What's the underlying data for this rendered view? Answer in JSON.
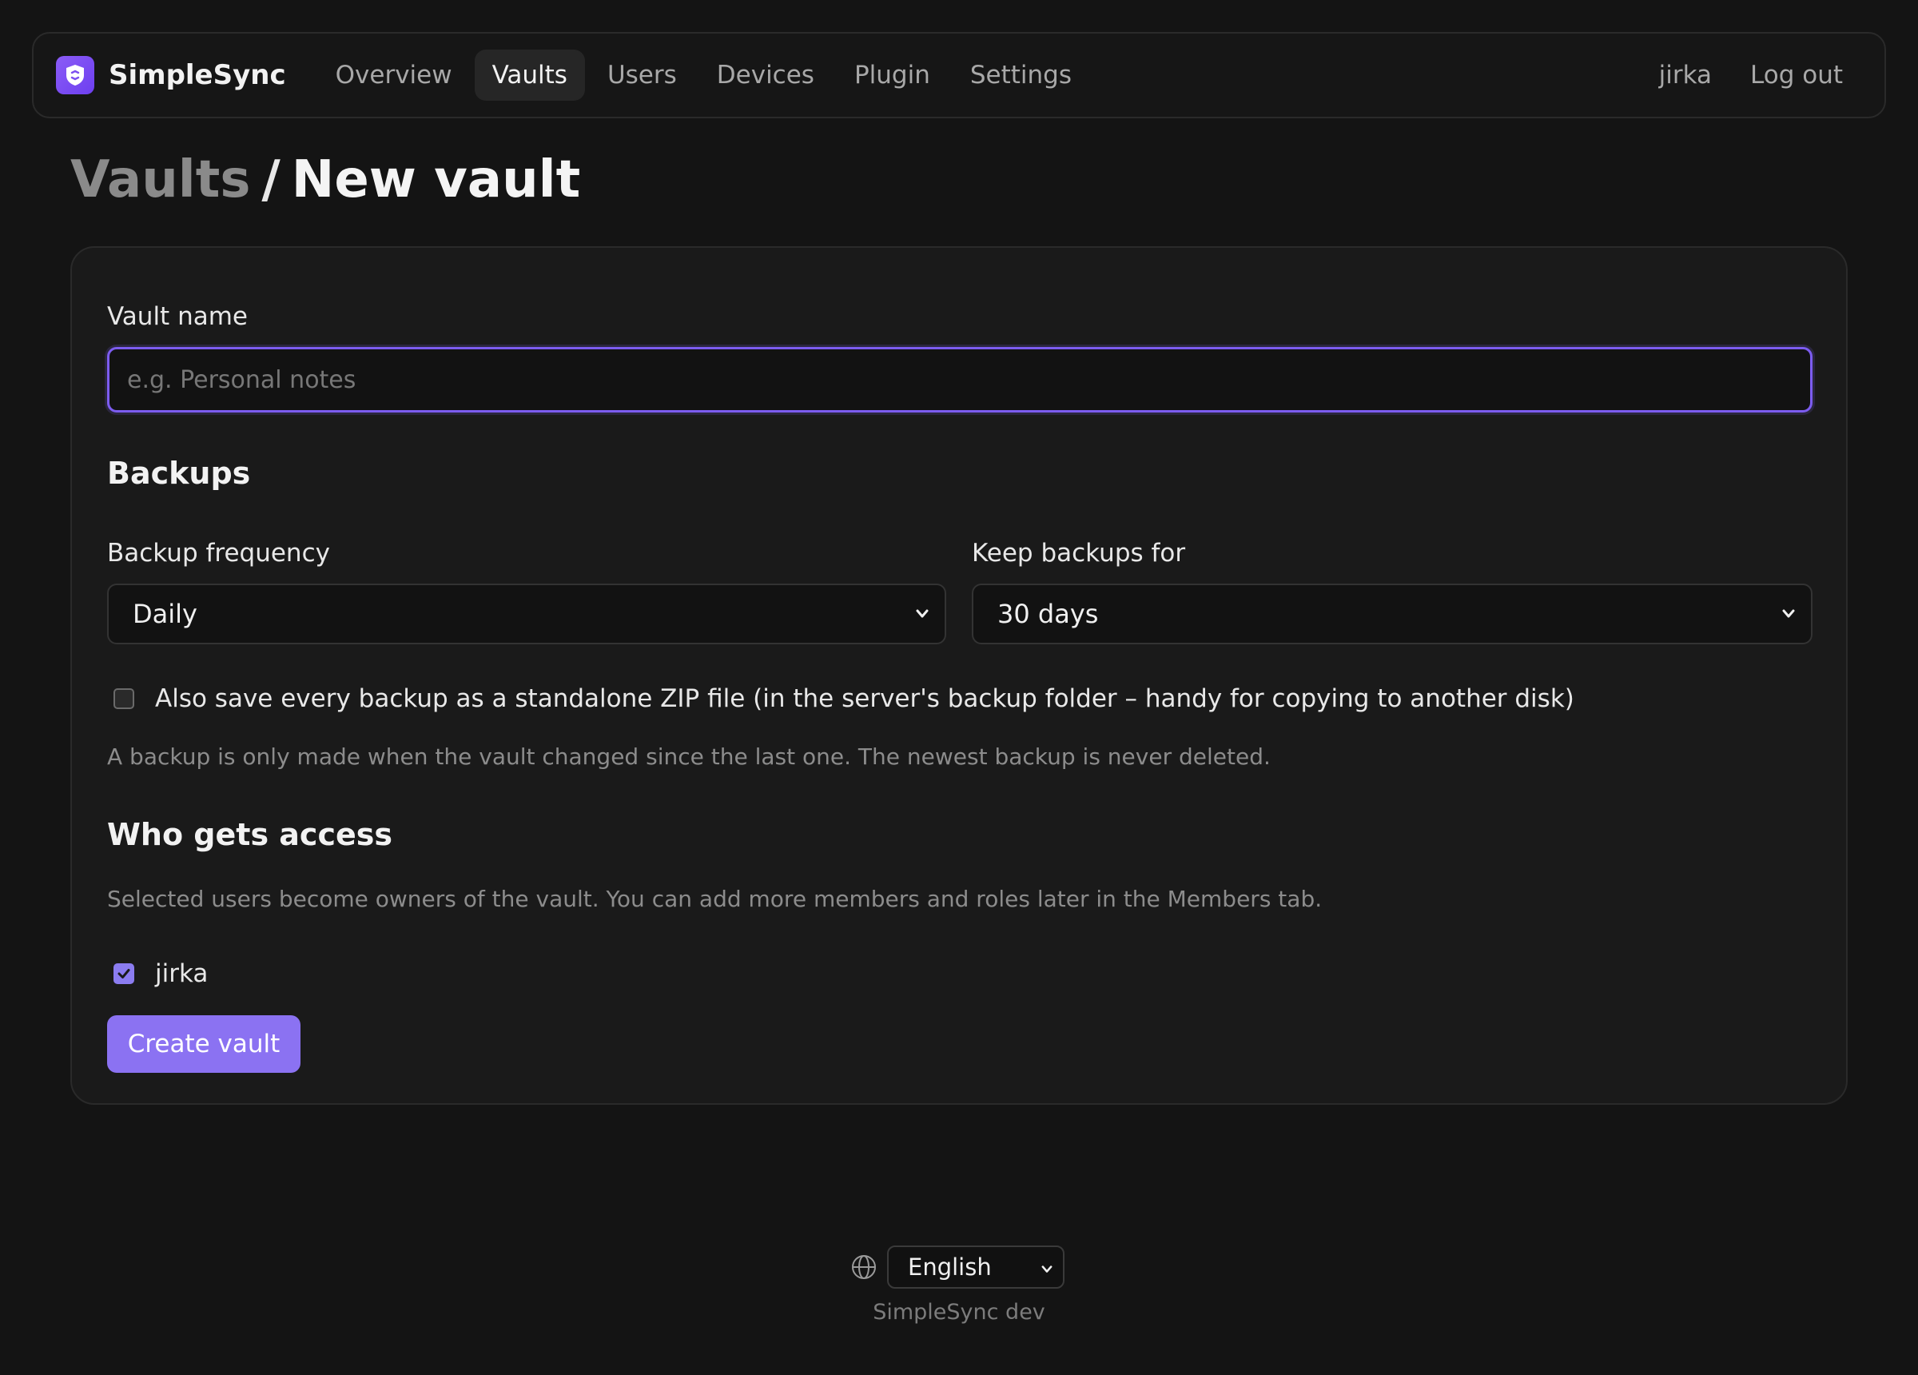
{
  "brand": {
    "name": "SimpleSync",
    "accent": "#8b5cf6"
  },
  "nav": {
    "items": [
      {
        "label": "Overview",
        "active": false
      },
      {
        "label": "Vaults",
        "active": true
      },
      {
        "label": "Users",
        "active": false
      },
      {
        "label": "Devices",
        "active": false
      },
      {
        "label": "Plugin",
        "active": false
      },
      {
        "label": "Settings",
        "active": false
      }
    ],
    "user": "jirka",
    "logout": "Log out"
  },
  "breadcrumb": {
    "parent": "Vaults",
    "separator": "/",
    "current": "New vault"
  },
  "form": {
    "vault_name": {
      "label": "Vault name",
      "value": "",
      "placeholder": "e.g. Personal notes"
    },
    "backups": {
      "title": "Backups",
      "frequency": {
        "label": "Backup frequency",
        "selected": "Daily"
      },
      "retention": {
        "label": "Keep backups for",
        "selected": "30 days"
      },
      "zip_option": {
        "label": "Also save every backup as a standalone ZIP file (in the server's backup folder – handy for copying to another disk)",
        "checked": false
      },
      "hint": "A backup is only made when the vault changed since the last one. The newest backup is never deleted."
    },
    "access": {
      "title": "Who gets access",
      "hint": "Selected users become owners of the vault. You can add more members and roles later in the Members tab.",
      "users": [
        {
          "name": "jirka",
          "checked": true
        }
      ]
    },
    "submit_label": "Create vault"
  },
  "footer": {
    "language": "English",
    "version_text": "SimpleSync dev",
    "icon": "globe-icon"
  },
  "colors": {
    "background": "#141414",
    "card": "#1a1a1a",
    "primary_button": "#8b72f2",
    "focus_ring": "#7c5cf0"
  }
}
